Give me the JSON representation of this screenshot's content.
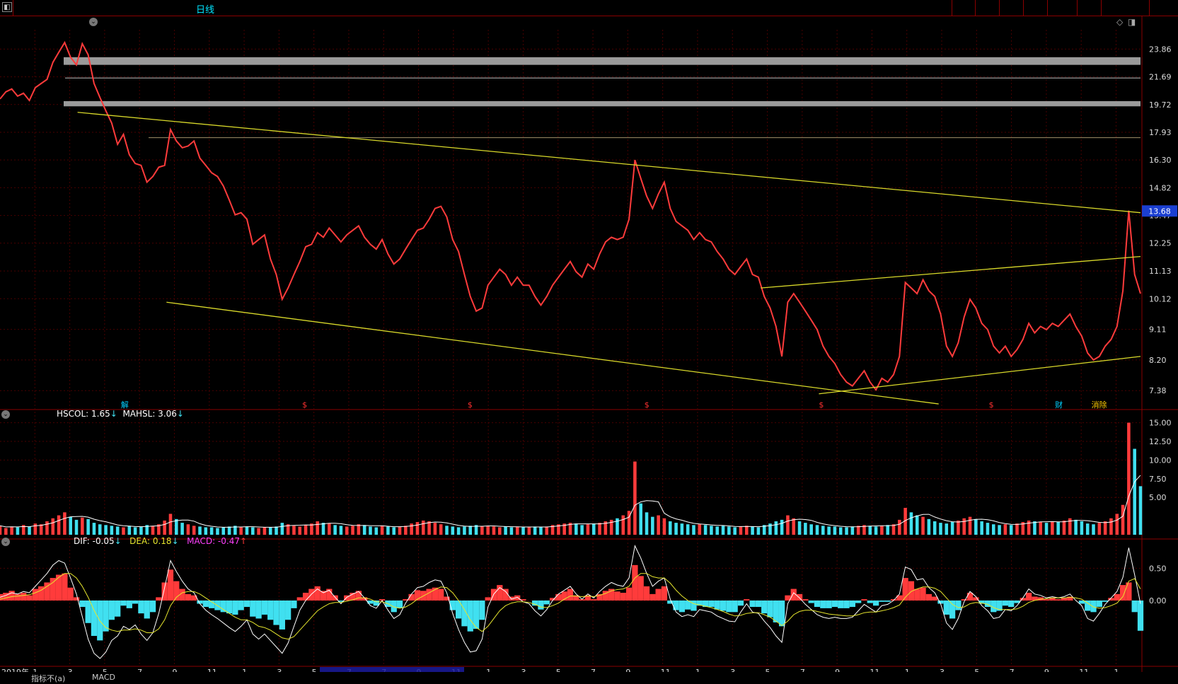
{
  "window": {
    "title": "日线"
  },
  "price_axis": [
    "23.86",
    "21.69",
    "19.72",
    "17.93",
    "16.30",
    "14.82",
    "13.47",
    "12.25",
    "11.13",
    "10.12",
    "9.11",
    "8.20",
    "7.38"
  ],
  "vol_axis": [
    "15.00",
    "12.50",
    "10.00",
    "7.50",
    "5.00"
  ],
  "macd_axis": [
    "0.50",
    "0.00"
  ],
  "current_price_tag": "13.68",
  "volume_indicator": {
    "label1": "HSCOL: 1.65",
    "arrow1": "↓",
    "label2": "MAHSL: 3.06",
    "arrow2": "↓"
  },
  "macd_indicator": {
    "dif": "DIF: -0.05",
    "dif_arrow": "↓",
    "dea": "DEA: 0.18",
    "dea_arrow": "↓",
    "macd": "MACD: -0.47",
    "macd_arrow": "↑"
  },
  "x_axis_labels": [
    "2019年",
    "1",
    "3",
    "5",
    "7",
    "9",
    "11",
    "1",
    "3",
    "5",
    "7",
    "7",
    "9",
    "11",
    "1",
    "3",
    "5",
    "7",
    "9",
    "11",
    "1",
    "3",
    "5",
    "7",
    "9",
    "11",
    "1",
    "3",
    "5",
    "7",
    "9",
    "11",
    "1"
  ],
  "event_markers": [
    {
      "text": "解",
      "color": "#00cfff"
    },
    {
      "text": "$",
      "color": "#ff3030"
    },
    {
      "text": "$",
      "color": "#ff3030"
    },
    {
      "text": "$",
      "color": "#ff3030"
    },
    {
      "text": "$",
      "color": "#ff3030"
    },
    {
      "text": "$",
      "color": "#ff3030"
    },
    {
      "text": "财",
      "color": "#00cfff"
    },
    {
      "text": "消除",
      "color": "#ffcc00"
    }
  ],
  "bottom_tabs": [
    "指标不(a)",
    "MACD"
  ],
  "colors": {
    "price_line": "#ff3b3b",
    "trend_line": "#d9d92a",
    "grid": "#4a0000",
    "up_bar": "#ff3b3b",
    "down_bar": "#40e0f0",
    "dif": "#ffffff",
    "dea": "#e6e62e",
    "macd_label": "#ff40ff",
    "axis_text": "#dddddd"
  },
  "chart_data": {
    "type": "line",
    "title": "日线",
    "ylabel": "",
    "y_scale": "log",
    "ylim": [
      7.0,
      25.5
    ],
    "series": [
      {
        "values": [
          20.1,
          20.6,
          20.8,
          20.3,
          20.5,
          20.0,
          20.9,
          21.2,
          21.5,
          22.8,
          23.6,
          24.4,
          23.2,
          22.6,
          24.3,
          23.4,
          21.2,
          20.2,
          19.3,
          18.5,
          17.2,
          17.8,
          16.6,
          16.1,
          16.0,
          15.1,
          15.4,
          15.9,
          16.0,
          18.1,
          17.4,
          17.0,
          17.1,
          17.4,
          16.4,
          16.0,
          15.6,
          15.4,
          14.9,
          14.2,
          13.5,
          13.6,
          13.3,
          12.2,
          12.4,
          12.6,
          11.6,
          11.0,
          10.1,
          10.5,
          11.0,
          11.5,
          12.1,
          12.2,
          12.7,
          12.5,
          12.9,
          12.6,
          12.3,
          12.6,
          12.8,
          13.0,
          12.5,
          12.2,
          12.0,
          12.4,
          11.8,
          11.4,
          11.6,
          12.0,
          12.4,
          12.8,
          12.9,
          13.3,
          13.8,
          13.9,
          13.4,
          12.4,
          11.9,
          11.0,
          10.2,
          9.7,
          9.8,
          10.6,
          10.9,
          11.2,
          11.0,
          10.6,
          10.9,
          10.6,
          10.6,
          10.2,
          9.9,
          10.2,
          10.6,
          10.9,
          11.2,
          11.5,
          11.1,
          10.9,
          11.4,
          11.2,
          11.8,
          12.3,
          12.5,
          12.4,
          12.5,
          13.3,
          16.3,
          15.3,
          14.4,
          13.8,
          14.5,
          15.1,
          13.8,
          13.2,
          13.0,
          12.8,
          12.4,
          12.7,
          12.4,
          12.3,
          11.9,
          11.6,
          11.2,
          11.0,
          11.3,
          11.6,
          11.0,
          10.9,
          10.2,
          9.8,
          9.2,
          8.3,
          10.0,
          10.3,
          10.0,
          9.7,
          9.4,
          9.1,
          8.6,
          8.3,
          8.1,
          7.8,
          7.6,
          7.5,
          7.7,
          7.9,
          7.6,
          7.4,
          7.7,
          7.6,
          7.8,
          8.3,
          10.7,
          10.5,
          10.3,
          10.8,
          10.4,
          10.2,
          9.6,
          8.6,
          8.3,
          8.7,
          9.5,
          10.1,
          9.8,
          9.3,
          9.1,
          8.6,
          8.4,
          8.6,
          8.3,
          8.5,
          8.8,
          9.3,
          9.0,
          9.2,
          9.1,
          9.3,
          9.2,
          9.4,
          9.6,
          9.2,
          8.9,
          8.4,
          8.2,
          8.3,
          8.6,
          8.8,
          9.2,
          10.4,
          13.7,
          11.0,
          10.3
        ]
      }
    ],
    "volume": {
      "ylim": [
        0,
        16
      ],
      "bars": [
        1.2,
        0.9,
        1.1,
        1.0,
        1.3,
        1.1,
        1.5,
        1.4,
        1.8,
        2.2,
        2.6,
        3.0,
        2.4,
        2.0,
        2.3,
        2.1,
        1.6,
        1.4,
        1.3,
        1.2,
        1.1,
        1.0,
        1.2,
        1.0,
        1.1,
        1.3,
        1.2,
        1.4,
        1.9,
        2.8,
        2.1,
        1.6,
        1.4,
        1.2,
        1.1,
        1.0,
        1.0,
        0.9,
        1.0,
        1.1,
        1.2,
        1.0,
        1.1,
        1.0,
        0.9,
        1.0,
        1.0,
        1.1,
        1.6,
        1.4,
        1.2,
        1.1,
        1.3,
        1.5,
        1.8,
        1.6,
        1.5,
        1.3,
        1.2,
        1.1,
        1.2,
        1.4,
        1.3,
        1.1,
        1.0,
        1.2,
        1.1,
        1.0,
        1.1,
        1.2,
        1.5,
        1.7,
        1.9,
        1.8,
        1.6,
        1.4,
        1.2,
        1.1,
        1.0,
        1.1,
        1.2,
        1.3,
        1.1,
        1.2,
        1.1,
        1.0,
        1.1,
        1.0,
        1.1,
        1.0,
        1.0,
        1.1,
        1.0,
        1.1,
        1.3,
        1.4,
        1.5,
        1.6,
        1.5,
        1.3,
        1.4,
        1.5,
        1.6,
        1.8,
        2.0,
        2.2,
        2.6,
        3.2,
        9.8,
        4.2,
        3.0,
        2.4,
        2.6,
        2.2,
        1.8,
        1.6,
        1.5,
        1.4,
        1.3,
        1.4,
        1.3,
        1.2,
        1.1,
        1.2,
        1.1,
        1.0,
        1.1,
        1.2,
        1.1,
        1.0,
        1.3,
        1.5,
        1.8,
        2.0,
        2.6,
        2.2,
        1.8,
        1.6,
        1.4,
        1.3,
        1.2,
        1.1,
        1.1,
        1.0,
        1.0,
        1.1,
        1.2,
        1.3,
        1.2,
        1.1,
        1.2,
        1.3,
        1.4,
        2.0,
        3.6,
        3.0,
        2.6,
        2.4,
        2.1,
        1.8,
        1.6,
        1.5,
        1.7,
        1.9,
        2.2,
        2.4,
        2.1,
        1.8,
        1.6,
        1.4,
        1.3,
        1.4,
        1.3,
        1.5,
        1.7,
        1.9,
        1.8,
        1.7,
        1.6,
        1.8,
        1.7,
        1.9,
        2.2,
        2.0,
        1.8,
        1.5,
        1.4,
        1.6,
        1.8,
        2.2,
        2.8,
        4.0,
        15.0,
        11.5,
        6.5
      ]
    },
    "macd": {
      "ylim": [
        -1.0,
        0.9
      ],
      "hist": [
        0.1,
        0.12,
        0.15,
        0.1,
        0.12,
        0.08,
        0.18,
        0.22,
        0.28,
        0.35,
        0.4,
        0.42,
        0.2,
        0.05,
        -0.1,
        -0.35,
        -0.55,
        -0.62,
        -0.48,
        -0.3,
        -0.25,
        -0.08,
        -0.12,
        -0.05,
        -0.2,
        -0.28,
        -0.18,
        0.05,
        0.28,
        0.48,
        0.3,
        0.18,
        0.1,
        0.08,
        -0.05,
        -0.1,
        -0.12,
        -0.15,
        -0.18,
        -0.2,
        -0.22,
        -0.15,
        -0.1,
        -0.25,
        -0.28,
        -0.22,
        -0.3,
        -0.38,
        -0.45,
        -0.3,
        -0.12,
        0.05,
        0.12,
        0.18,
        0.22,
        0.15,
        0.18,
        0.08,
        -0.02,
        0.08,
        0.12,
        0.15,
        0.05,
        -0.05,
        -0.08,
        0.02,
        -0.1,
        -0.18,
        -0.12,
        0.02,
        0.1,
        0.16,
        0.15,
        0.18,
        0.2,
        0.18,
        0.06,
        -0.15,
        -0.28,
        -0.4,
        -0.48,
        -0.44,
        -0.3,
        0.05,
        0.18,
        0.24,
        0.18,
        0.06,
        0.08,
        0.02,
        0.0,
        -0.08,
        -0.14,
        -0.06,
        0.04,
        0.1,
        0.14,
        0.18,
        0.08,
        0.02,
        0.08,
        0.02,
        0.1,
        0.15,
        0.18,
        0.14,
        0.12,
        0.2,
        0.55,
        0.38,
        0.22,
        0.1,
        0.18,
        0.22,
        -0.05,
        -0.15,
        -0.18,
        -0.14,
        -0.16,
        -0.08,
        -0.1,
        -0.1,
        -0.14,
        -0.16,
        -0.18,
        -0.18,
        -0.08,
        0.02,
        -0.1,
        -0.1,
        -0.2,
        -0.26,
        -0.34,
        -0.4,
        0.08,
        0.18,
        0.1,
        0.02,
        -0.04,
        -0.1,
        -0.12,
        -0.12,
        -0.1,
        -0.12,
        -0.12,
        -0.1,
        -0.04,
        0.02,
        -0.04,
        -0.08,
        -0.02,
        -0.02,
        0.02,
        0.08,
        0.35,
        0.3,
        0.18,
        0.2,
        0.1,
        0.06,
        -0.05,
        -0.22,
        -0.28,
        -0.15,
        0.02,
        0.12,
        0.05,
        -0.05,
        -0.1,
        -0.18,
        -0.16,
        -0.08,
        -0.1,
        -0.04,
        0.04,
        0.12,
        0.06,
        0.05,
        0.02,
        0.04,
        0.02,
        0.04,
        0.06,
        0.0,
        -0.05,
        -0.16,
        -0.18,
        -0.1,
        -0.02,
        0.04,
        0.1,
        0.24,
        0.28,
        -0.18,
        -0.47
      ],
      "dif": [
        0.05,
        0.08,
        0.12,
        0.1,
        0.14,
        0.12,
        0.22,
        0.32,
        0.42,
        0.55,
        0.62,
        0.58,
        0.35,
        0.1,
        -0.25,
        -0.6,
        -0.82,
        -0.9,
        -0.8,
        -0.62,
        -0.55,
        -0.4,
        -0.45,
        -0.38,
        -0.52,
        -0.62,
        -0.5,
        -0.2,
        0.2,
        0.62,
        0.45,
        0.3,
        0.18,
        0.12,
        -0.05,
        -0.15,
        -0.22,
        -0.28,
        -0.35,
        -0.42,
        -0.48,
        -0.4,
        -0.3,
        -0.52,
        -0.6,
        -0.52,
        -0.62,
        -0.72,
        -0.82,
        -0.66,
        -0.4,
        -0.15,
        0.0,
        0.1,
        0.18,
        0.12,
        0.16,
        0.05,
        -0.05,
        0.05,
        0.1,
        0.14,
        0.04,
        -0.08,
        -0.12,
        0.0,
        -0.15,
        -0.28,
        -0.22,
        -0.04,
        0.1,
        0.2,
        0.22,
        0.28,
        0.32,
        0.3,
        0.12,
        -0.2,
        -0.45,
        -0.65,
        -0.8,
        -0.78,
        -0.6,
        -0.1,
        0.1,
        0.2,
        0.14,
        0.02,
        0.05,
        -0.02,
        -0.05,
        -0.16,
        -0.24,
        -0.14,
        0.0,
        0.1,
        0.16,
        0.22,
        0.1,
        0.02,
        0.1,
        0.04,
        0.14,
        0.22,
        0.28,
        0.24,
        0.22,
        0.35,
        0.85,
        0.66,
        0.42,
        0.22,
        0.3,
        0.35,
        0.02,
        -0.18,
        -0.25,
        -0.22,
        -0.25,
        -0.14,
        -0.16,
        -0.18,
        -0.24,
        -0.28,
        -0.32,
        -0.33,
        -0.18,
        -0.05,
        -0.18,
        -0.2,
        -0.32,
        -0.42,
        -0.55,
        -0.65,
        -0.05,
        0.12,
        0.04,
        -0.06,
        -0.14,
        -0.22,
        -0.26,
        -0.28,
        -0.26,
        -0.28,
        -0.28,
        -0.26,
        -0.16,
        -0.06,
        -0.12,
        -0.18,
        -0.08,
        -0.06,
        0.0,
        0.1,
        0.52,
        0.48,
        0.32,
        0.34,
        0.2,
        0.12,
        -0.05,
        -0.35,
        -0.45,
        -0.28,
        -0.02,
        0.14,
        0.06,
        -0.08,
        -0.16,
        -0.28,
        -0.26,
        -0.14,
        -0.16,
        -0.08,
        0.04,
        0.18,
        0.1,
        0.08,
        0.04,
        0.06,
        0.04,
        0.06,
        0.1,
        0.0,
        -0.08,
        -0.28,
        -0.32,
        -0.2,
        -0.06,
        0.04,
        0.14,
        0.36,
        0.82,
        0.4,
        -0.05
      ],
      "dea": [
        0.02,
        0.04,
        0.06,
        0.07,
        0.08,
        0.09,
        0.12,
        0.16,
        0.22,
        0.28,
        0.36,
        0.42,
        0.42,
        0.35,
        0.22,
        0.05,
        -0.15,
        -0.32,
        -0.42,
        -0.46,
        -0.48,
        -0.46,
        -0.46,
        -0.44,
        -0.46,
        -0.5,
        -0.5,
        -0.44,
        -0.3,
        -0.08,
        0.05,
        0.12,
        0.14,
        0.14,
        0.1,
        0.04,
        -0.02,
        -0.08,
        -0.14,
        -0.2,
        -0.26,
        -0.3,
        -0.3,
        -0.34,
        -0.4,
        -0.42,
        -0.46,
        -0.52,
        -0.58,
        -0.6,
        -0.56,
        -0.46,
        -0.36,
        -0.26,
        -0.16,
        -0.1,
        -0.05,
        -0.03,
        -0.03,
        -0.01,
        0.01,
        0.04,
        0.04,
        0.02,
        -0.02,
        -0.02,
        -0.05,
        -0.1,
        -0.12,
        -0.1,
        -0.05,
        0.02,
        0.07,
        0.12,
        0.17,
        0.21,
        0.2,
        0.12,
        0.0,
        -0.14,
        -0.3,
        -0.42,
        -0.48,
        -0.4,
        -0.28,
        -0.16,
        -0.08,
        -0.04,
        -0.02,
        -0.02,
        -0.03,
        -0.06,
        -0.1,
        -0.11,
        -0.08,
        -0.04,
        0.02,
        0.07,
        0.07,
        0.06,
        0.07,
        0.06,
        0.08,
        0.11,
        0.15,
        0.17,
        0.18,
        0.22,
        0.35,
        0.42,
        0.42,
        0.37,
        0.35,
        0.35,
        0.27,
        0.16,
        0.07,
        0.0,
        -0.05,
        -0.07,
        -0.09,
        -0.11,
        -0.14,
        -0.17,
        -0.21,
        -0.24,
        -0.23,
        -0.2,
        -0.19,
        -0.19,
        -0.22,
        -0.26,
        -0.32,
        -0.39,
        -0.32,
        -0.22,
        -0.17,
        -0.15,
        -0.15,
        -0.17,
        -0.19,
        -0.21,
        -0.22,
        -0.23,
        -0.24,
        -0.24,
        -0.22,
        -0.19,
        -0.18,
        -0.18,
        -0.16,
        -0.14,
        -0.11,
        -0.07,
        0.05,
        0.14,
        0.18,
        0.21,
        0.21,
        0.19,
        0.14,
        0.04,
        -0.06,
        -0.11,
        -0.1,
        -0.05,
        -0.03,
        -0.04,
        -0.06,
        -0.11,
        -0.14,
        -0.14,
        -0.14,
        -0.13,
        -0.09,
        -0.03,
        0.0,
        0.02,
        0.03,
        0.04,
        0.04,
        0.04,
        0.05,
        0.04,
        0.02,
        -0.04,
        -0.1,
        -0.12,
        -0.11,
        -0.08,
        -0.04,
        0.06,
        0.3,
        0.34,
        0.18
      ]
    },
    "trend_lines": [
      {
        "from": [
          0.068,
          19.2
        ],
        "to": [
          1.0,
          13.6
        ]
      },
      {
        "from": [
          0.146,
          10.0
        ],
        "to": [
          0.823,
          7.05
        ]
      },
      {
        "from": [
          0.718,
          7.3
        ],
        "to": [
          1.0,
          8.3
        ]
      },
      {
        "from": [
          0.667,
          10.5
        ],
        "to": [
          1.0,
          11.7
        ]
      }
    ],
    "resistance_bands": [
      {
        "low": 22.6,
        "high": 23.2
      },
      {
        "low": 19.6,
        "high": 19.95
      }
    ],
    "horizontal_lines": [
      21.6,
      17.6
    ]
  }
}
